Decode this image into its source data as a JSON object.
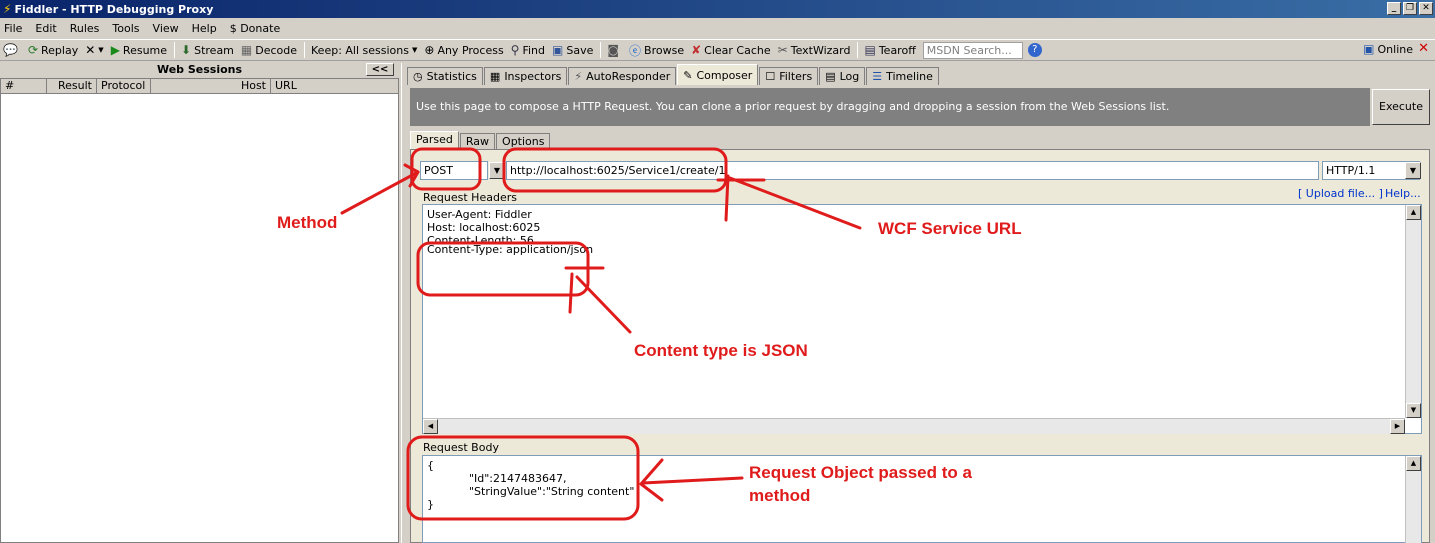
{
  "window": {
    "title": "Fiddler - HTTP Debugging Proxy"
  },
  "menu": [
    "File",
    "Edit",
    "Rules",
    "Tools",
    "View",
    "Help",
    "$ Donate"
  ],
  "toolbar": {
    "replay": "Replay",
    "remove": "X",
    "resume": "Resume",
    "stream": "Stream",
    "decode": "Decode",
    "keep": "Keep: All sessions",
    "any_process": "Any Process",
    "find": "Find",
    "save": "Save",
    "browse": "Browse",
    "clear_cache": "Clear Cache",
    "textwizard": "TextWizard",
    "tearoff": "Tearoff",
    "msdn_placeholder": "MSDN Search...",
    "online": "Online"
  },
  "sessions": {
    "title": "Web Sessions",
    "collapse": "<<",
    "columns": [
      "#",
      "Result",
      "Protocol",
      "Host",
      "URL"
    ]
  },
  "tabs": [
    "Statistics",
    "Inspectors",
    "AutoResponder",
    "Composer",
    "Filters",
    "Log",
    "Timeline"
  ],
  "composer": {
    "description": "Use this page to compose a HTTP Request. You can clone a prior request by dragging and dropping a session from the Web Sessions list.",
    "execute": "Execute",
    "subtabs": [
      "Parsed",
      "Raw",
      "Options"
    ],
    "method": "POST",
    "url": "http://localhost:6025/Service1/create/1",
    "version": "HTTP/1.1",
    "headers_label": "Request Headers",
    "upload_link": "[ Upload file... ]",
    "help_link": "Help...",
    "headers": [
      "User-Agent: Fiddler",
      "Host: localhost:6025",
      "Content-Length: 56",
      "Content-Type: application/json"
    ],
    "body_label": "Request Body",
    "body": "{\n            \"Id\":2147483647,\n            \"StringValue\":\"String content\"\n}"
  },
  "annotations": {
    "method": "Method",
    "url": "WCF Service URL",
    "content_type": "Content type is JSON",
    "body_line1": "Request Object passed to a",
    "body_line2": "method"
  },
  "colors": {
    "annotation": "#e01b1b",
    "title_bar": "#0a246a"
  }
}
